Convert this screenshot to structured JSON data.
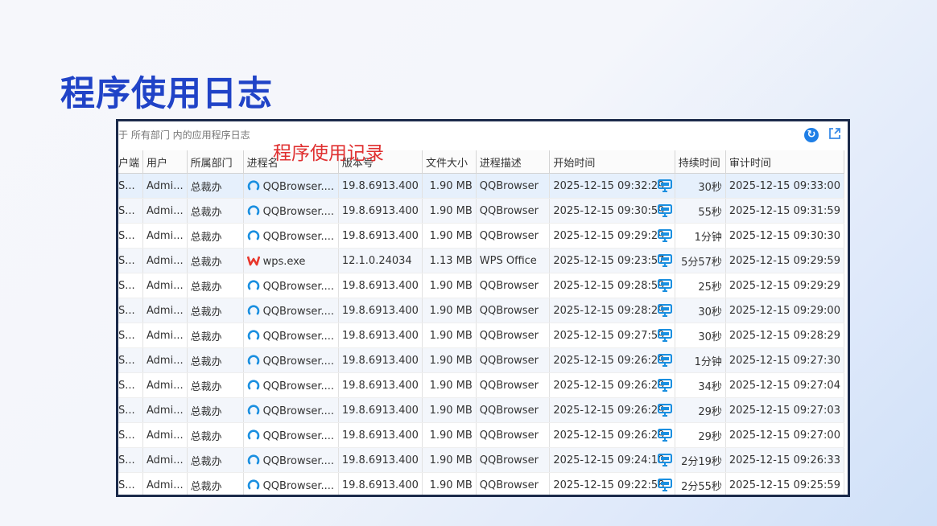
{
  "page_title": "程序使用日志",
  "header_caption": "于 所有部门 内的应用程序日志",
  "annotation": "程序使用记录",
  "columns": [
    "户端",
    "用户",
    "所属部门",
    "进程名",
    "版本号",
    "文件大小",
    "进程描述",
    "开始时间",
    "持续时间",
    "审计时间"
  ],
  "colors": {
    "title": "#2043c7",
    "annotation": "#e03030",
    "qq_icon": "#1a8fe0",
    "wps_icon": "#e8362b",
    "monitor_icon": "#1a8fe0"
  },
  "rows": [
    {
      "client": "S...",
      "user": "Admi...",
      "dept": "总裁办",
      "icon": "qqbrowser-icon",
      "proc": "QQBrowser....",
      "ver": "19.8.6913.400",
      "size": "1.90 MB",
      "desc": "QQBrowser",
      "start": "2025-12-15 09:32:29",
      "dur": "30秒",
      "audit": "2025-12-15 09:33:00"
    },
    {
      "client": "S...",
      "user": "Admi...",
      "dept": "总裁办",
      "icon": "qqbrowser-icon",
      "proc": "QQBrowser....",
      "ver": "19.8.6913.400",
      "size": "1.90 MB",
      "desc": "QQBrowser",
      "start": "2025-12-15 09:30:59",
      "dur": "55秒",
      "audit": "2025-12-15 09:31:59"
    },
    {
      "client": "S...",
      "user": "Admi...",
      "dept": "总裁办",
      "icon": "qqbrowser-icon",
      "proc": "QQBrowser....",
      "ver": "19.8.6913.400",
      "size": "1.90 MB",
      "desc": "QQBrowser",
      "start": "2025-12-15 09:29:29",
      "dur": "1分钟",
      "audit": "2025-12-15 09:30:30"
    },
    {
      "client": "S...",
      "user": "Admi...",
      "dept": "总裁办",
      "icon": "wps-icon",
      "proc": "wps.exe",
      "ver": "12.1.0.24034",
      "size": "1.13 MB",
      "desc": "WPS Office",
      "start": "2025-12-15 09:23:57",
      "dur": "5分57秒",
      "audit": "2025-12-15 09:29:59"
    },
    {
      "client": "S...",
      "user": "Admi...",
      "dept": "总裁办",
      "icon": "qqbrowser-icon",
      "proc": "QQBrowser....",
      "ver": "19.8.6913.400",
      "size": "1.90 MB",
      "desc": "QQBrowser",
      "start": "2025-12-15 09:28:59",
      "dur": "25秒",
      "audit": "2025-12-15 09:29:29"
    },
    {
      "client": "S...",
      "user": "Admi...",
      "dept": "总裁办",
      "icon": "qqbrowser-icon",
      "proc": "QQBrowser....",
      "ver": "19.8.6913.400",
      "size": "1.90 MB",
      "desc": "QQBrowser",
      "start": "2025-12-15 09:28:29",
      "dur": "30秒",
      "audit": "2025-12-15 09:29:00"
    },
    {
      "client": "S...",
      "user": "Admi...",
      "dept": "总裁办",
      "icon": "qqbrowser-icon",
      "proc": "QQBrowser....",
      "ver": "19.8.6913.400",
      "size": "1.90 MB",
      "desc": "QQBrowser",
      "start": "2025-12-15 09:27:59",
      "dur": "30秒",
      "audit": "2025-12-15 09:28:29"
    },
    {
      "client": "S...",
      "user": "Admi...",
      "dept": "总裁办",
      "icon": "qqbrowser-icon",
      "proc": "QQBrowser....",
      "ver": "19.8.6913.400",
      "size": "1.90 MB",
      "desc": "QQBrowser",
      "start": "2025-12-15 09:26:29",
      "dur": "1分钟",
      "audit": "2025-12-15 09:27:30"
    },
    {
      "client": "S...",
      "user": "Admi...",
      "dept": "总裁办",
      "icon": "qqbrowser-icon",
      "proc": "QQBrowser....",
      "ver": "19.8.6913.400",
      "size": "1.90 MB",
      "desc": "QQBrowser",
      "start": "2025-12-15 09:26:29",
      "dur": "34秒",
      "audit": "2025-12-15 09:27:04"
    },
    {
      "client": "S...",
      "user": "Admi...",
      "dept": "总裁办",
      "icon": "qqbrowser-icon",
      "proc": "QQBrowser....",
      "ver": "19.8.6913.400",
      "size": "1.90 MB",
      "desc": "QQBrowser",
      "start": "2025-12-15 09:26:29",
      "dur": "29秒",
      "audit": "2025-12-15 09:27:03"
    },
    {
      "client": "S...",
      "user": "Admi...",
      "dept": "总裁办",
      "icon": "qqbrowser-icon",
      "proc": "QQBrowser....",
      "ver": "19.8.6913.400",
      "size": "1.90 MB",
      "desc": "QQBrowser",
      "start": "2025-12-15 09:26:29",
      "dur": "29秒",
      "audit": "2025-12-15 09:27:00"
    },
    {
      "client": "S...",
      "user": "Admi...",
      "dept": "总裁办",
      "icon": "qqbrowser-icon",
      "proc": "QQBrowser....",
      "ver": "19.8.6913.400",
      "size": "1.90 MB",
      "desc": "QQBrowser",
      "start": "2025-12-15 09:24:10",
      "dur": "2分19秒",
      "audit": "2025-12-15 09:26:33"
    },
    {
      "client": "S...",
      "user": "Admi...",
      "dept": "总裁办",
      "icon": "qqbrowser-icon",
      "proc": "QQBrowser....",
      "ver": "19.8.6913.400",
      "size": "1.90 MB",
      "desc": "QQBrowser",
      "start": "2025-12-15 09:22:58",
      "dur": "2分55秒",
      "audit": "2025-12-15 09:25:59"
    }
  ]
}
